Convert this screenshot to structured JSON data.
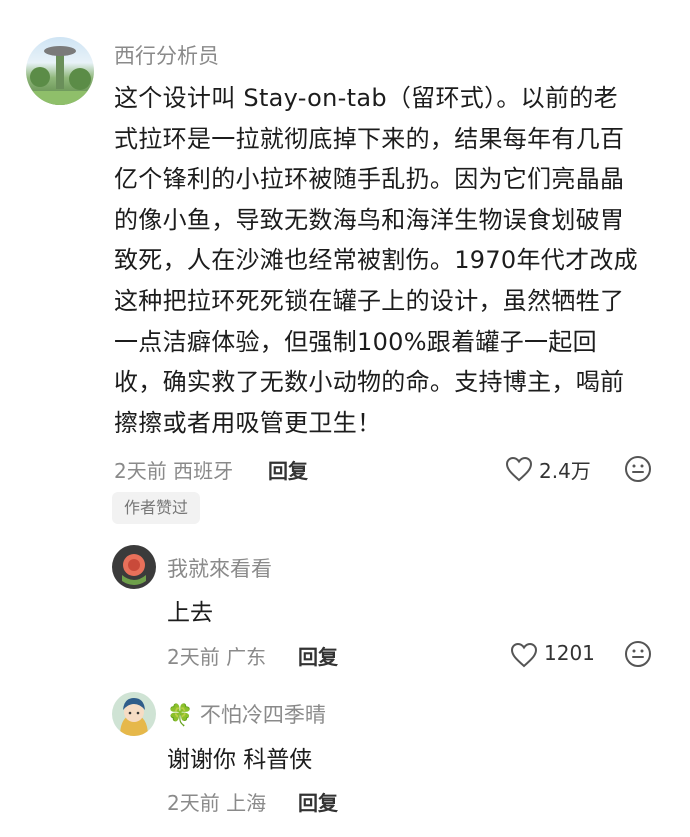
{
  "comment": {
    "author": "西行分析员",
    "lines": [
      "这个设计叫 Stay-on-tab（留环式）。以前的老",
      "式拉环是一拉就彻底掉下来的，结果每年有几百",
      "亿个锋利的小拉环被随手乱扔。因为它们亮晶晶",
      "的像小鱼，导致无数海鸟和海洋生物误食划破胃",
      "致死，人在沙滩也经常被割伤。1970年代才改成",
      "这种把拉环死死锁在罐子上的设计，虽然牺牲了",
      "一点洁癖体验，但强制100%跟着罐子一起回",
      "收，确实救了无数小动物的命。支持博主，喝前",
      "擦擦或者用吸管更卫生！"
    ],
    "time_location": "2天前 西班牙",
    "reply_label": "回复",
    "likes": "2.4万",
    "author_liked": "作者赞过"
  },
  "replies": [
    {
      "author": "我就來看看",
      "text": "上去",
      "time_location": "2天前 广东",
      "reply_label": "回复",
      "likes": "1201"
    },
    {
      "author_prefix": "🍀",
      "author": "不怕冷四季晴",
      "text": "谢谢你 科普侠",
      "time_location": "2天前 上海",
      "reply_label": "回复"
    }
  ],
  "colors": {
    "muted": "#8a8a8a",
    "text": "#1c1c1c",
    "badge_bg": "#f2f2f2"
  }
}
